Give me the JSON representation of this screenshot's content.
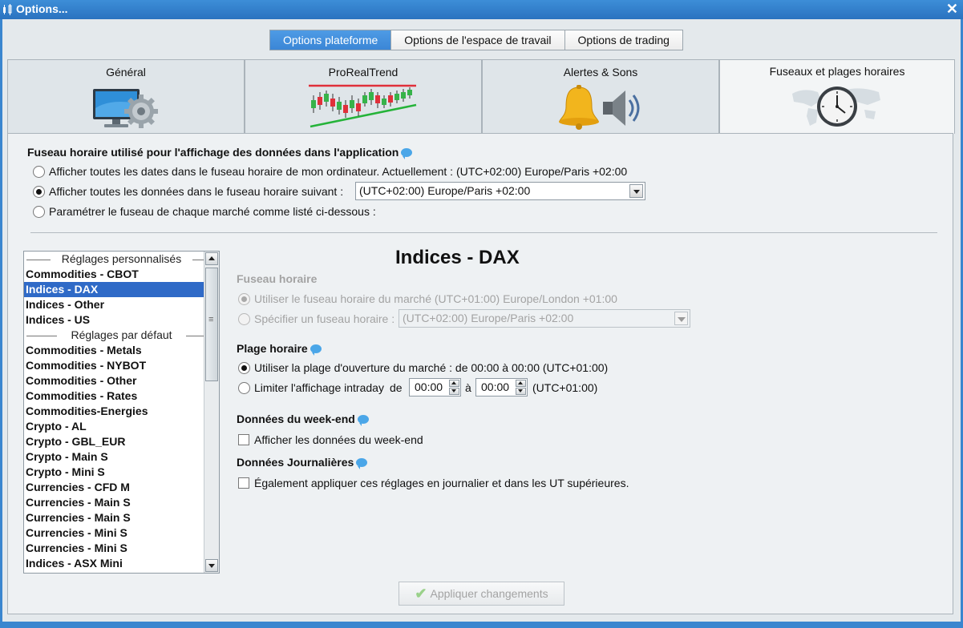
{
  "window": {
    "title": "Options...",
    "close_label": "✕"
  },
  "top_tabs": [
    {
      "label": "Options plateforme",
      "active": true
    },
    {
      "label": "Options de l'espace de travail",
      "active": false
    },
    {
      "label": "Options de trading",
      "active": false
    }
  ],
  "sub_tabs": [
    {
      "label": "Général",
      "icon": "computer-settings-icon"
    },
    {
      "label": "ProRealTrend",
      "icon": "trend-chart-icon"
    },
    {
      "label": "Alertes & Sons",
      "icon": "bell-speaker-icon"
    },
    {
      "label": "Fuseaux et plages horaires",
      "icon": "world-clock-icon",
      "active": true
    }
  ],
  "timezone_section": {
    "title": "Fuseau horaire utilisé pour l'affichage des données dans l'application",
    "option_computer": "Afficher toutes les dates dans le fuseau horaire de mon ordinateur. Actuellement : (UTC+02:00) Europe/Paris +02:00",
    "option_following": "Afficher toutes les données dans le fuseau horaire suivant :",
    "option_following_value": "(UTC+02:00) Europe/Paris +02:00",
    "option_per_market": "Paramétrer le fuseau de chaque marché comme listé ci-dessous :",
    "selected": "following"
  },
  "market_list": {
    "group_custom": "Réglages personnalisés",
    "custom_items": [
      "Commodities - CBOT",
      "Indices - DAX",
      "Indices - Other",
      "Indices - US"
    ],
    "group_default": "Réglages par défaut",
    "default_items": [
      "Commodities - Metals",
      "Commodities - NYBOT",
      "Commodities - Other",
      "Commodities - Rates",
      "Commodities-Energies",
      "Crypto - AL",
      "Crypto - GBL_EUR",
      "Crypto - Main S",
      "Crypto - Mini S",
      "Currencies - CFD M",
      "Currencies - Main S",
      "Currencies - Main S",
      "Currencies - Mini S",
      "Currencies - Mini S",
      "Indices - ASX Mini"
    ],
    "selected": "Indices - DAX"
  },
  "detail": {
    "title": "Indices - DAX",
    "tz_title": "Fuseau horaire",
    "tz_option_market": "Utiliser le fuseau horaire du marché (UTC+01:00) Europe/London +01:00",
    "tz_option_specify": "Spécifier un fuseau horaire :",
    "tz_specify_value": "(UTC+02:00) Europe/Paris +02:00",
    "range_title": "Plage horaire",
    "range_option_open": "Utiliser la plage d'ouverture du marché : de 00:00 à 00:00  (UTC+01:00)",
    "range_option_limit": "Limiter l'affichage intraday",
    "range_from_label": "de",
    "range_from_value": "00:00",
    "range_to_label": "à",
    "range_to_value": "00:00",
    "range_tz": "(UTC+01:00)",
    "weekend_title": "Données du week-end",
    "weekend_option": "Afficher les données du week-end",
    "daily_title": "Données Journalières",
    "daily_option": "Également appliquer ces réglages en journalier et dans les UT supérieures."
  },
  "apply_button": "Appliquer changements",
  "colors": {
    "accent": "#3b86d6",
    "selection": "#2f6ac7",
    "title_bar": "#2a72bf"
  }
}
